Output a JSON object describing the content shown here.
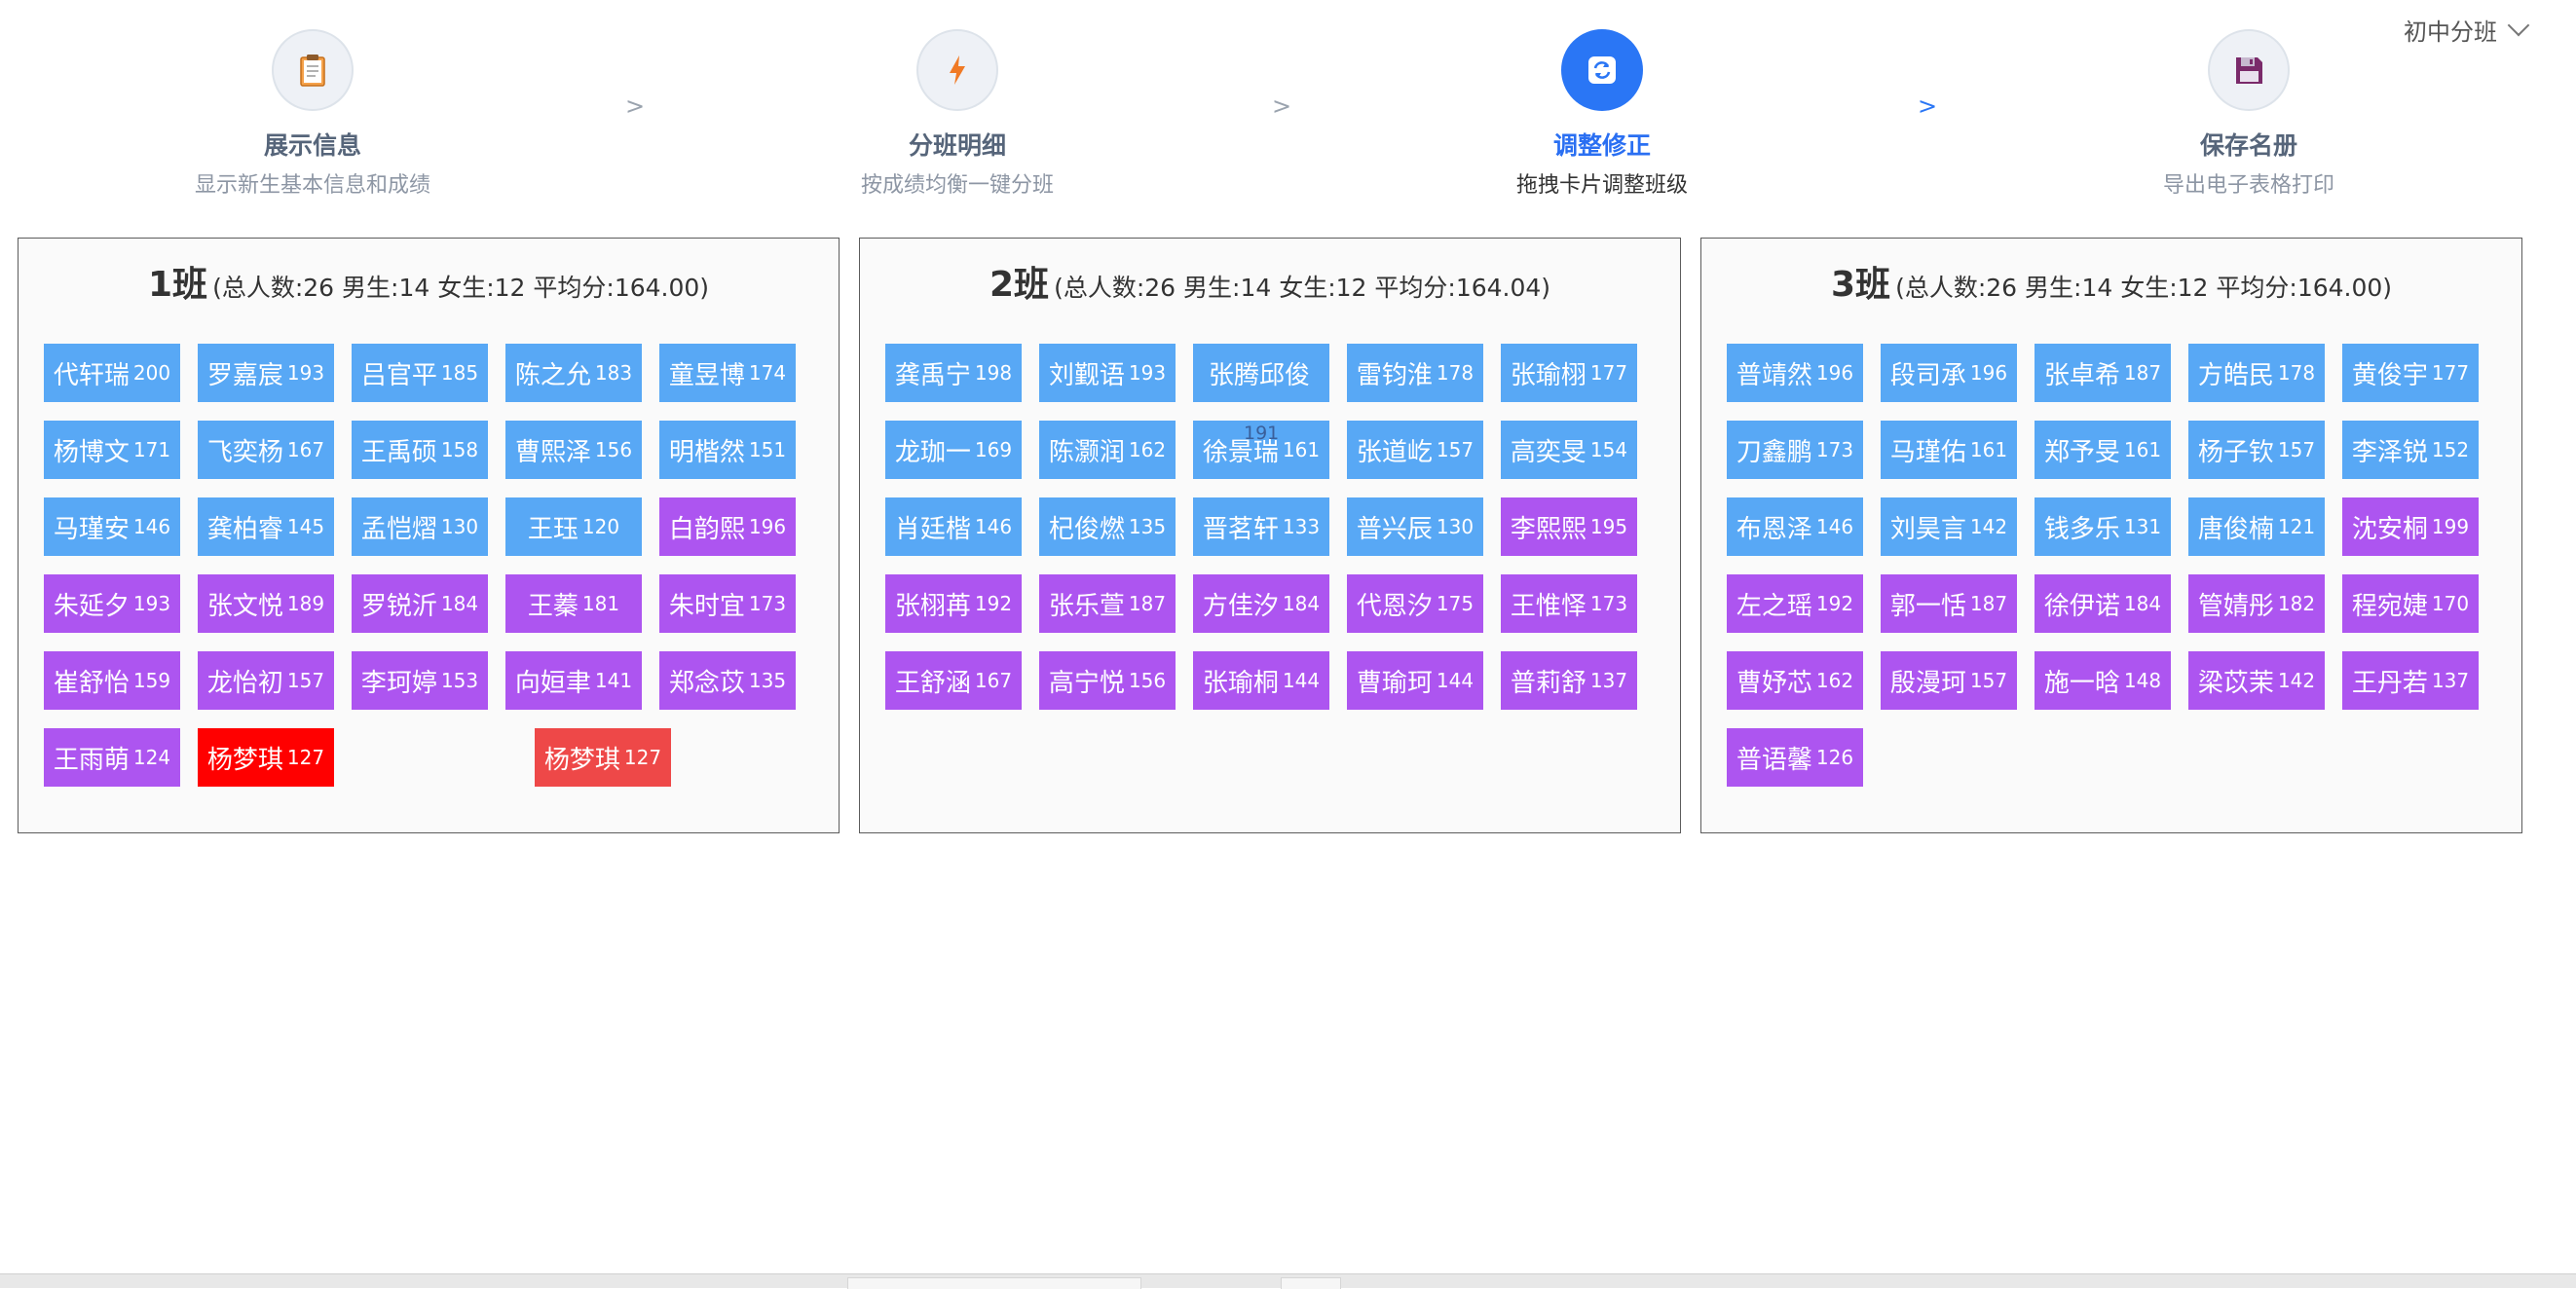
{
  "grade_select": {
    "value": "初中分班"
  },
  "steps": [
    {
      "title": "展示信息",
      "desc": "显示新生基本信息和成绩",
      "icon": "clipboard-icon"
    },
    {
      "title": "分班明细",
      "desc": "按成绩均衡一键分班",
      "icon": "lightning-icon"
    },
    {
      "title": "调整修正",
      "desc": "拖拽卡片调整班级",
      "icon": "swap-icon",
      "active": true
    },
    {
      "title": "保存名册",
      "desc": "导出电子表格打印",
      "icon": "floppy-disk-icon"
    }
  ],
  "step_separator": ">",
  "classes": [
    {
      "name": "1班",
      "stats": "(总人数:26 男生:14 女生:12 平均分:164.00)",
      "students": [
        {
          "name": "代轩瑞",
          "score": "200",
          "gender": "male"
        },
        {
          "name": "罗嘉宸",
          "score": "193",
          "gender": "male"
        },
        {
          "name": "吕官平",
          "score": "185",
          "gender": "male"
        },
        {
          "name": "陈之允",
          "score": "183",
          "gender": "male"
        },
        {
          "name": "童昱博",
          "score": "174",
          "gender": "male"
        },
        {
          "name": "杨博文",
          "score": "171",
          "gender": "male"
        },
        {
          "name": "飞奕杨",
          "score": "167",
          "gender": "male"
        },
        {
          "name": "王禹硕",
          "score": "158",
          "gender": "male"
        },
        {
          "name": "曹熙泽",
          "score": "156",
          "gender": "male"
        },
        {
          "name": "明楷然",
          "score": "151",
          "gender": "male"
        },
        {
          "name": "马瑾安",
          "score": "146",
          "gender": "male"
        },
        {
          "name": "龚柏睿",
          "score": "145",
          "gender": "male"
        },
        {
          "name": "孟恺熠",
          "score": "130",
          "gender": "male"
        },
        {
          "name": "王珏",
          "score": "120",
          "gender": "male"
        },
        {
          "name": "白韵熙",
          "score": "196",
          "gender": "female"
        },
        {
          "name": "朱延夕",
          "score": "193",
          "gender": "female"
        },
        {
          "name": "张文悦",
          "score": "189",
          "gender": "female"
        },
        {
          "name": "罗锐沂",
          "score": "184",
          "gender": "female"
        },
        {
          "name": "王蓁",
          "score": "181",
          "gender": "female"
        },
        {
          "name": "朱时宜",
          "score": "173",
          "gender": "female"
        },
        {
          "name": "崔舒怡",
          "score": "159",
          "gender": "female"
        },
        {
          "name": "龙怡初",
          "score": "157",
          "gender": "female"
        },
        {
          "name": "李珂婷",
          "score": "153",
          "gender": "female"
        },
        {
          "name": "向姮聿",
          "score": "141",
          "gender": "female"
        },
        {
          "name": "郑念苡",
          "score": "135",
          "gender": "female"
        },
        {
          "name": "王雨萌",
          "score": "124",
          "gender": "female"
        },
        {
          "name": "杨梦琪",
          "score": "127",
          "gender": "drag-red"
        }
      ],
      "drag_ghost": {
        "name": "杨梦琪",
        "score": "127"
      }
    },
    {
      "name": "2班",
      "stats": "(总人数:26 男生:14 女生:12 平均分:164.04)",
      "students": [
        {
          "name": "龚禹宁",
          "score": "198",
          "gender": "male"
        },
        {
          "name": "刘觐语",
          "score": "193",
          "gender": "male"
        },
        {
          "name": "张腾邱俊",
          "score": "",
          "gender": "male"
        },
        {
          "name": "雷钧淮",
          "score": "178",
          "gender": "male"
        },
        {
          "name": "张瑜栩",
          "score": "177",
          "gender": "male"
        },
        {
          "name": "龙珈一",
          "score": "169",
          "gender": "male"
        },
        {
          "name": "陈灏润",
          "score": "162",
          "gender": "male"
        },
        {
          "name": "徐景瑞",
          "score": "161",
          "gender": "male"
        },
        {
          "name": "张道屹",
          "score": "157",
          "gender": "male"
        },
        {
          "name": "高奕旻",
          "score": "154",
          "gender": "male"
        },
        {
          "name": "肖廷楷",
          "score": "146",
          "gender": "male"
        },
        {
          "name": "杞俊燃",
          "score": "135",
          "gender": "male"
        },
        {
          "name": "晋茗轩",
          "score": "133",
          "gender": "male"
        },
        {
          "name": "普兴辰",
          "score": "130",
          "gender": "male"
        },
        {
          "name": "李熙熙",
          "score": "195",
          "gender": "female"
        },
        {
          "name": "张栩苒",
          "score": "192",
          "gender": "female"
        },
        {
          "name": "张乐萱",
          "score": "187",
          "gender": "female"
        },
        {
          "name": "方佳汐",
          "score": "184",
          "gender": "female"
        },
        {
          "name": "代恩汐",
          "score": "175",
          "gender": "female"
        },
        {
          "name": "王惟怿",
          "score": "173",
          "gender": "female"
        },
        {
          "name": "王舒涵",
          "score": "167",
          "gender": "female"
        },
        {
          "name": "高宁悦",
          "score": "156",
          "gender": "female"
        },
        {
          "name": "张瑜桐",
          "score": "144",
          "gender": "female"
        },
        {
          "name": "曹瑜珂",
          "score": "144",
          "gender": "female"
        },
        {
          "name": "普莉舒",
          "score": "137",
          "gender": "female"
        }
      ],
      "overlay_number": "191"
    },
    {
      "name": "3班",
      "stats": "(总人数:26 男生:14 女生:12 平均分:164.00)",
      "students": [
        {
          "name": "普靖然",
          "score": "196",
          "gender": "male"
        },
        {
          "name": "段司承",
          "score": "196",
          "gender": "male"
        },
        {
          "name": "张卓希",
          "score": "187",
          "gender": "male"
        },
        {
          "name": "方皓民",
          "score": "178",
          "gender": "male"
        },
        {
          "name": "黄俊宇",
          "score": "177",
          "gender": "male"
        },
        {
          "name": "刀鑫鹏",
          "score": "173",
          "gender": "male"
        },
        {
          "name": "马瑾佑",
          "score": "161",
          "gender": "male"
        },
        {
          "name": "郑予旻",
          "score": "161",
          "gender": "male"
        },
        {
          "name": "杨子钦",
          "score": "157",
          "gender": "male"
        },
        {
          "name": "李泽锐",
          "score": "152",
          "gender": "male"
        },
        {
          "name": "布恩泽",
          "score": "146",
          "gender": "male"
        },
        {
          "name": "刘昊言",
          "score": "142",
          "gender": "male"
        },
        {
          "name": "钱多乐",
          "score": "131",
          "gender": "male"
        },
        {
          "name": "唐俊楠",
          "score": "121",
          "gender": "male"
        },
        {
          "name": "沈安桐",
          "score": "199",
          "gender": "female"
        },
        {
          "name": "左之瑶",
          "score": "192",
          "gender": "female"
        },
        {
          "name": "郭一恬",
          "score": "187",
          "gender": "female"
        },
        {
          "name": "徐伊诺",
          "score": "184",
          "gender": "female"
        },
        {
          "name": "管婧彤",
          "score": "182",
          "gender": "female"
        },
        {
          "name": "程宛婕",
          "score": "170",
          "gender": "female"
        },
        {
          "name": "曹妤芯",
          "score": "162",
          "gender": "female"
        },
        {
          "name": "殷漫珂",
          "score": "157",
          "gender": "female"
        },
        {
          "name": "施一晗",
          "score": "148",
          "gender": "female"
        },
        {
          "name": "梁苡茉",
          "score": "142",
          "gender": "female"
        },
        {
          "name": "王丹若",
          "score": "137",
          "gender": "female"
        },
        {
          "name": "普语馨",
          "score": "126",
          "gender": "female"
        }
      ]
    }
  ]
}
